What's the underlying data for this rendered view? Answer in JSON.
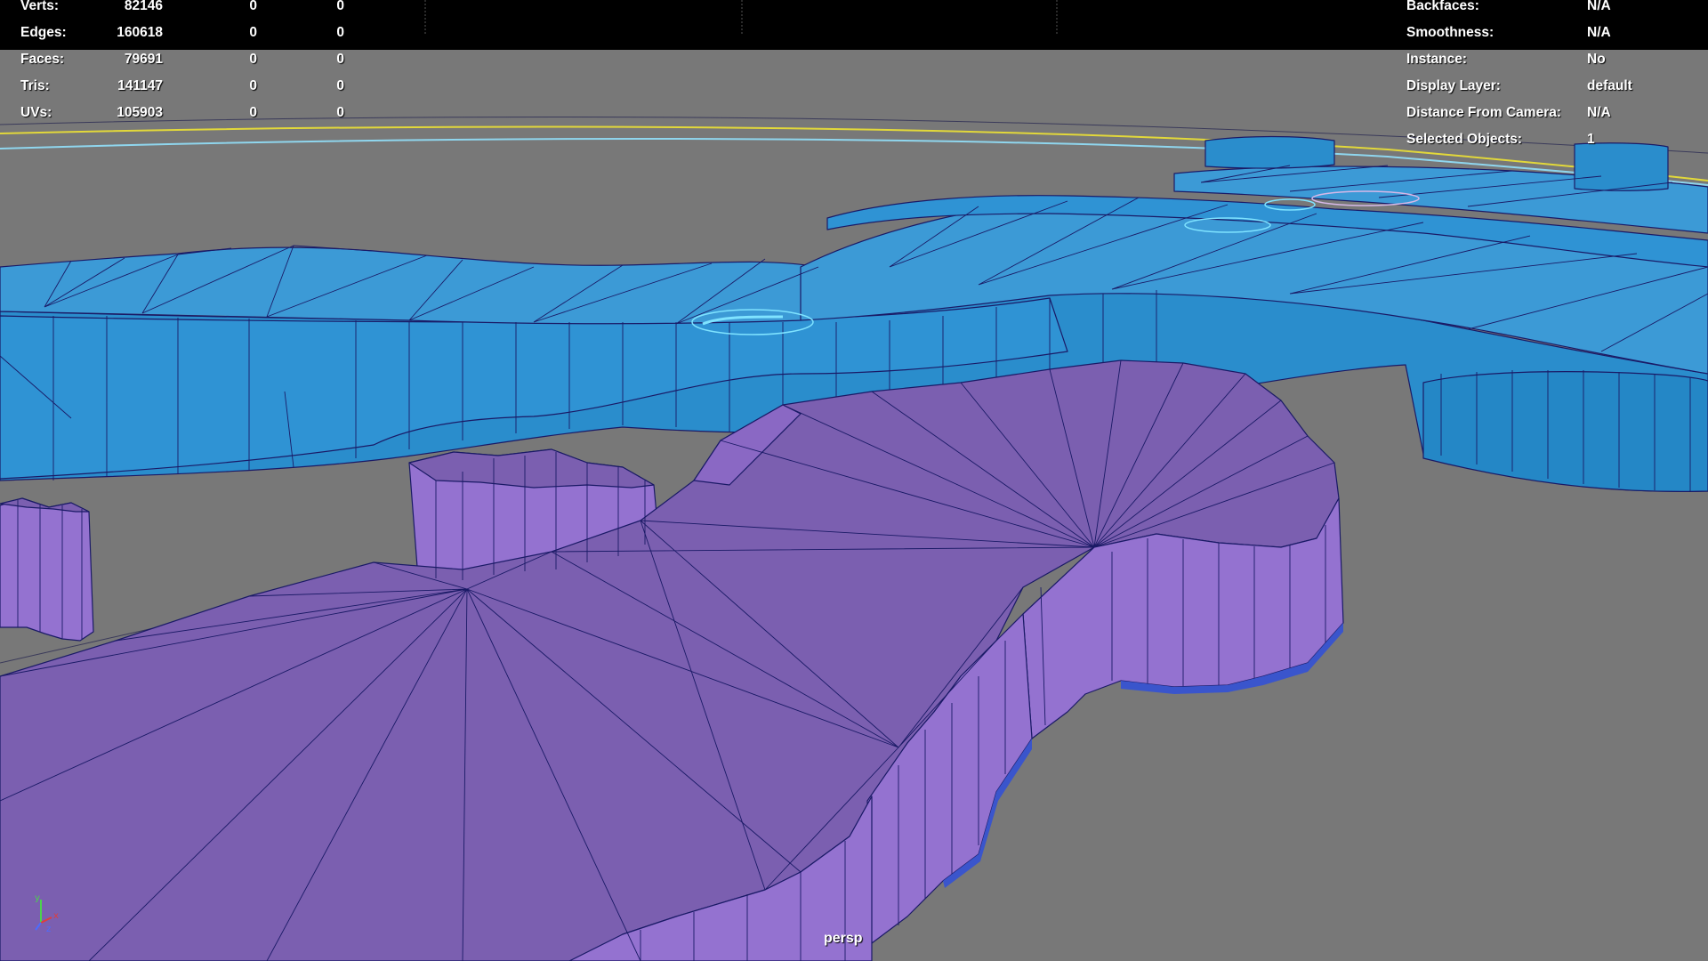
{
  "viewport": {
    "camera_name": "persp",
    "background_color": "#787878",
    "colors": {
      "header_band": "#000000",
      "blue_mesh": "#2a8dcc",
      "blue_mesh_top": "#3c9ad6",
      "purple_mesh": "#7b5fb0",
      "purple_mesh_side": "#9472d0",
      "wireframe": "#1a1a66",
      "selection_highlight": "#7fe3ff",
      "grid_line_yellow": "#e2d83a",
      "grid_line_cyan": "#8fd6ee"
    }
  },
  "heads_up_display": {
    "poly_count": [
      {
        "label": "Verts:",
        "values": [
          "82146",
          "0",
          "0"
        ]
      },
      {
        "label": "Edges:",
        "values": [
          "160618",
          "0",
          "0"
        ]
      },
      {
        "label": "Faces:",
        "values": [
          "79691",
          "0",
          "0"
        ]
      },
      {
        "label": "Tris:",
        "values": [
          "141147",
          "0",
          "0"
        ]
      },
      {
        "label": "UVs:",
        "values": [
          "105903",
          "0",
          "0"
        ]
      }
    ],
    "object_details": [
      {
        "label": "Backfaces:",
        "value": "N/A"
      },
      {
        "label": "Smoothness:",
        "value": "N/A"
      },
      {
        "label": "Instance:",
        "value": "No"
      },
      {
        "label": "Display Layer:",
        "value": "default"
      },
      {
        "label": "Distance From Camera:",
        "value": "N/A"
      },
      {
        "label": "Selected Objects:",
        "value": "1"
      }
    ]
  },
  "axis_gizmo": {
    "icon": "axis-gizmo-icon",
    "axes": [
      "y",
      "x",
      "z"
    ],
    "colors": {
      "x": "#e03c3c",
      "y": "#4cd24c",
      "z": "#4c6cff"
    }
  }
}
